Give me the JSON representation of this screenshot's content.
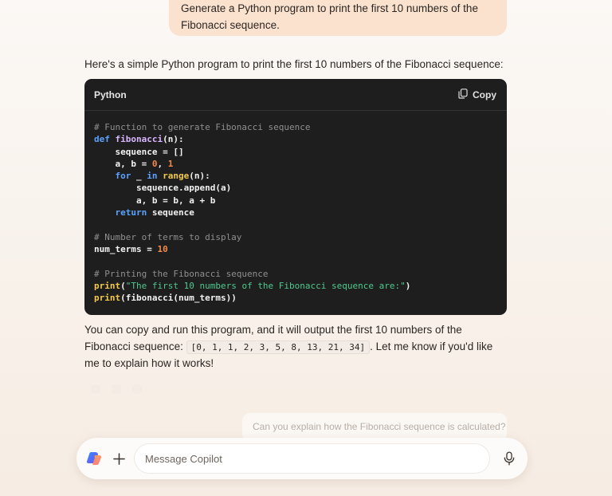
{
  "user_message": {
    "line1": "Generate a Python program to print the first 10 numbers of the",
    "line2": "Fibonacci sequence."
  },
  "assistant": {
    "intro": "Here's a simple Python program to print the first 10 numbers of the Fibonacci sequence:",
    "code_block": {
      "language": "Python",
      "copy_label": "Copy",
      "comment1": "# Function to generate Fibonacci sequence",
      "kw_def": "def",
      "fn_name": "fibonacci",
      "fn_params": "(n):",
      "line_seq_init": "sequence = []",
      "line_ab_a": "a, b = ",
      "num_0": "0",
      "comma": ", ",
      "num_1": "1",
      "kw_for": "for",
      "for_var": " _ ",
      "kw_in": "in",
      "bi_range": "range",
      "range_args": "(n):",
      "line_append": "sequence.append(a)",
      "line_ab_update": "a, b = b, a + b",
      "kw_return": "return",
      "return_val": " sequence",
      "comment2": "# Number of terms to display",
      "num_terms_assign": "num_terms = ",
      "num_10": "10",
      "comment3": "# Printing the Fibonacci sequence",
      "bi_print": "print",
      "open_paren": "(",
      "string_literal": "\"The first 10 numbers of the Fibonacci sequence are:\"",
      "close_paren": ")",
      "print_call_args": "(fibonacci(num_terms))"
    },
    "outro_part1": "You can copy and run this program, and it will output the first 10 numbers of the Fibonacci sequence: ",
    "outro_code": "[0, 1, 1, 2, 3, 5, 8, 13, 21, 34]",
    "outro_part2": ". Let me know if you'd like me to explain how it works!"
  },
  "suggestion": "Can you explain how the Fibonacci sequence is calculated?",
  "composer": {
    "placeholder": "Message Copilot"
  },
  "icons": [
    "copy-icon",
    "copilot-logo-icon",
    "plus-icon",
    "microphone-icon"
  ]
}
